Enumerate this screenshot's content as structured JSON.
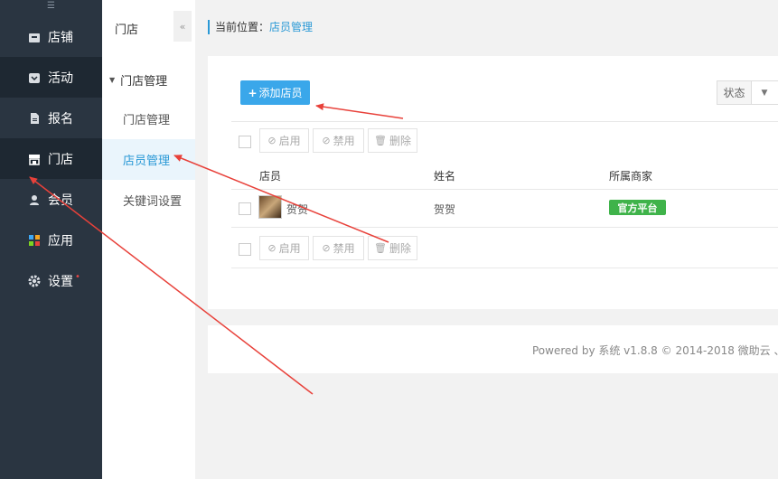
{
  "sidebar": {
    "toggle_icon": "menu-collapse-icon",
    "items": [
      {
        "label": "店铺",
        "icon": "shop-icon"
      },
      {
        "label": "活动",
        "icon": "activity-icon"
      },
      {
        "label": "报名",
        "icon": "document-icon"
      },
      {
        "label": "门店",
        "icon": "store-icon"
      },
      {
        "label": "会员",
        "icon": "user-icon"
      },
      {
        "label": "应用",
        "icon": "apps-icon"
      },
      {
        "label": "设置",
        "icon": "gear-icon",
        "dot": "•"
      }
    ]
  },
  "subnav": {
    "title": "门店",
    "collapse": "«",
    "group": "门店管理",
    "items": [
      {
        "label": "门店管理"
      },
      {
        "label": "店员管理"
      },
      {
        "label": "关键词设置"
      }
    ]
  },
  "breadcrumb": {
    "prefix": "当前位置：",
    "current": "店员管理"
  },
  "toolbar": {
    "add_label": "添加店员",
    "add_icon": "+",
    "status_label": "状态",
    "status_arrow": "▼"
  },
  "actions": {
    "enable": "启用",
    "disable": "禁用",
    "delete": "删除"
  },
  "table": {
    "headers": [
      "店员",
      "姓名",
      "所属商家"
    ],
    "rows": [
      {
        "clerk": "贺贺",
        "name": "贺贺",
        "merchant": "官方平台"
      }
    ]
  },
  "footer": {
    "text": "Powered by 系统 v1.8.8 © 2014-2018 微助云 、 "
  },
  "colors": {
    "sidebar_bg": "#2a3541",
    "accent": "#2a99d6",
    "add_button": "#3aa7ea",
    "badge_green": "#3fb34a",
    "annotation_arrow": "#e8413a"
  }
}
